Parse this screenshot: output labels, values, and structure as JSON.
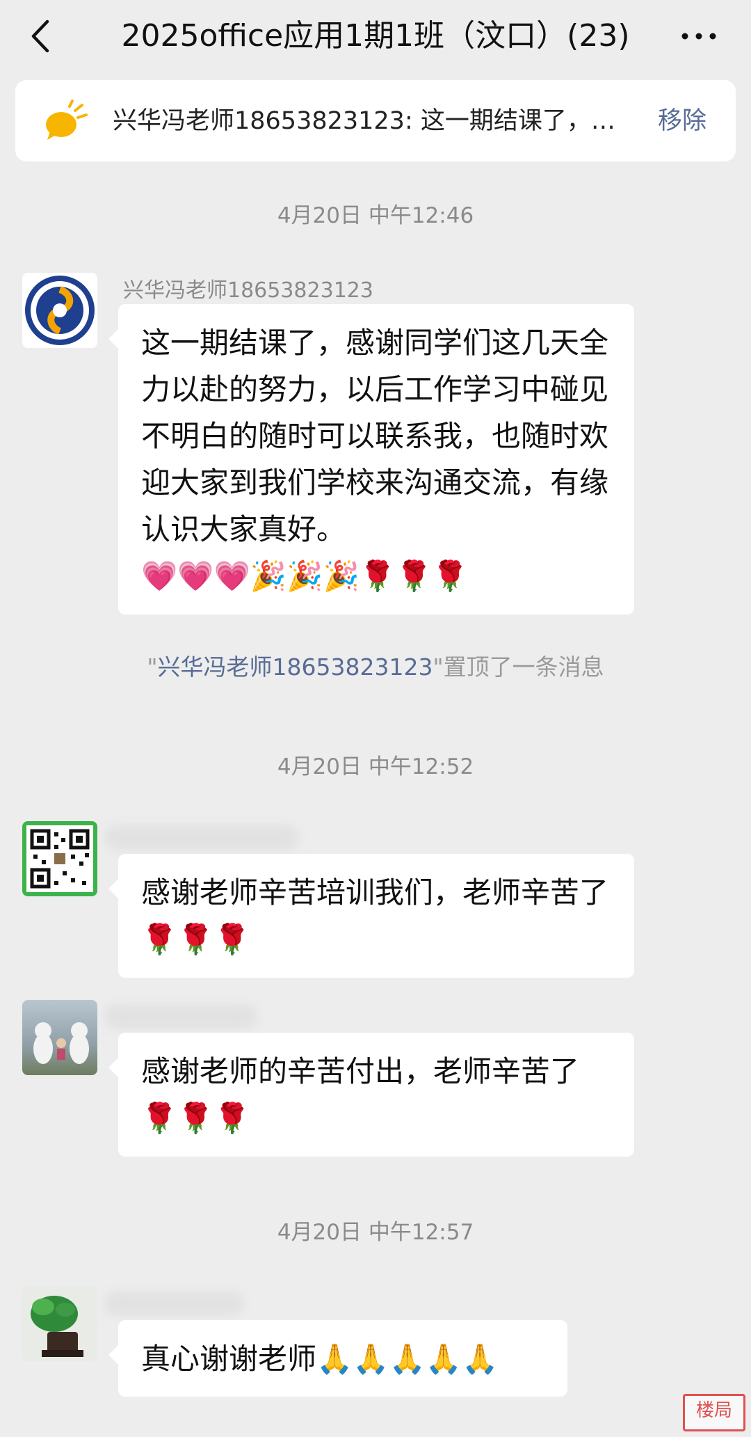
{
  "header": {
    "title": "2025office应用1期1班（汶口）(23)",
    "back_icon": "chevron-left-icon",
    "more_icon": "more-dots-icon"
  },
  "pinned": {
    "icon": "pinned-message-icon",
    "text": "兴华冯老师18653823123: 这一期结课了，…",
    "remove_label": "移除"
  },
  "chat": {
    "ts1": "4月20日 中午12:46",
    "msg1": {
      "sender": "兴华冯老师18653823123",
      "avatar": "school-logo-avatar",
      "text": "这一期结课了，感谢同学们这几天全力以赴的努力，以后工作学习中碰见不明白的随时可以联系我，也随时欢迎大家到我们学校来沟通交流，有缘认识大家真好。",
      "emoji": "💗💗💗🎉🎉🎉🌹🌹🌹"
    },
    "system_pin": {
      "quote_open": "\"",
      "name": "兴华冯老师18653823123",
      "rest": "\"置顶了一条消息"
    },
    "ts2": "4月20日 中午12:52",
    "msg2": {
      "avatar": "qr-code-avatar",
      "text": "感谢老师辛苦培训我们，老师辛苦了🌹🌹🌹"
    },
    "msg3": {
      "avatar": "photo-avatar",
      "text": "感谢老师的辛苦付出，老师辛苦了🌹🌹🌹"
    },
    "ts3": "4月20日 中午12:57",
    "msg4": {
      "avatar": "plant-photo-avatar",
      "text": "真心谢谢老师🙏🙏🙏🙏🙏"
    }
  },
  "colors": {
    "background": "#ededed",
    "bubble": "#ffffff",
    "link": "#576b95",
    "timestamp": "#8a8a8a",
    "qr_border": "#3cb34a"
  },
  "watermark": {
    "text": "楼局"
  }
}
